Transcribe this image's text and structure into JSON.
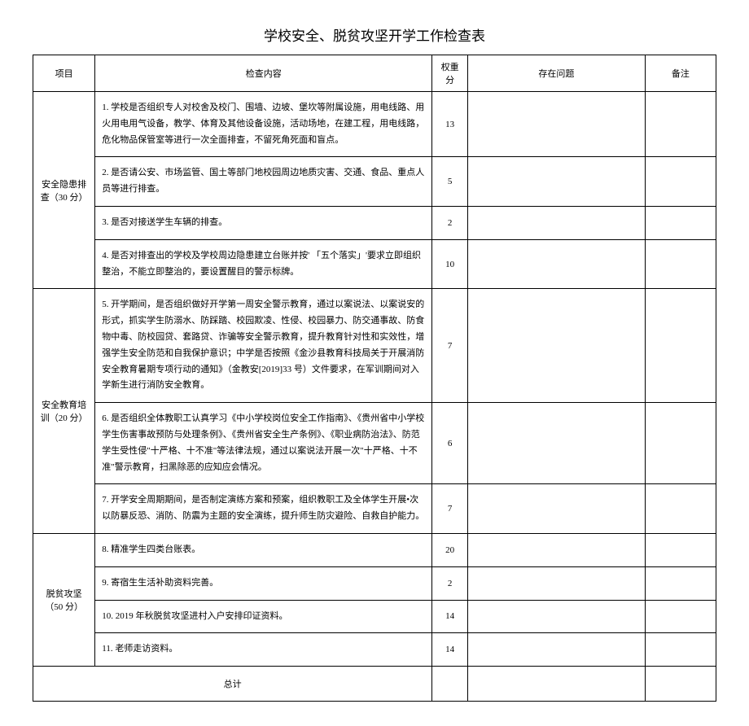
{
  "title": "学校安全、脱贫攻坚开学工作检查表",
  "headers": {
    "project": "项目",
    "content": "检查内容",
    "weight": "权重分",
    "issue": "存在问题",
    "remark": "备注"
  },
  "sections": [
    {
      "name": "安全隐患排查（30 分）",
      "rows": [
        {
          "content": "1. 学校是否组织专人对校舍及校门、围墙、边坡、堡坎等附属设施，用电线路、用火用电用气设备，教学、体育及其他设备设施，活动场地，在建工程，用电线路，危化物品保管室等进行一次全面排查，不留死角死面和盲点。",
          "weight": "13"
        },
        {
          "content": "2. 是否请公安、市场监管、国土等部门地校园周边地质灾害、交通、食品、重点人员等进行排查。",
          "weight": "5"
        },
        {
          "content": "3. 是否对接送学生车辆的排查。",
          "weight": "2"
        },
        {
          "content": "4. 是否对排查出的学校及学校周边隐患建立台账并按' 「五个落实」'要求立即组织整治，不能立即整治的，要设置醒目的警示标牌。",
          "weight": "10"
        }
      ]
    },
    {
      "name": "安全教育培训（20 分）",
      "rows": [
        {
          "content": "5. 开学期间，是否组织做好开学第一周安全警示教育，通过以案说法、以案说安的形式，抓实学生防溺水、防踩踏、校园欺凌、性侵、校园暴力、防交通事故、防食物中毒、防校园贷、套路贷、诈骗等安全警示教育，提升教育针对性和实效性，增强学生安全防范和自我保护意识；中学是否按照《金沙县教育科技局关于开展消防安全教育暑期专项行动的通知》（金教安[2019]33 号）文件要求，在军训期间对入学新生进行消防安全教育。",
          "weight": "7"
        },
        {
          "content": "6. 是否组织全体教职工认真学习《中小学校岗位安全工作指南》、《贵州省中小学校学生伤害事故预防与处理条例》、《贵州省安全生产条例》、《职业病防治法》、防范学生受性侵\"十严格、十不准\"等法律法规，通过以案说法开展一次\"十严格、十不准\"警示教育，扫黑除恶的应知应会情况。",
          "weight": "6"
        },
        {
          "content": "7. 开学安全周期期间，是否制定演练方案和预案，组织教职工及全体学生开展•次以防暴反恐、消防、防震为主题的安全演练，提升师生防灾避险、自救自护能力。",
          "weight": "7"
        }
      ]
    },
    {
      "name": "脱贫攻坚（50 分）",
      "rows": [
        {
          "content": "8. 精准学生四类台账表。",
          "weight": "20"
        },
        {
          "content": "9. 寄宿生生活补助资料完善。",
          "weight": "2"
        },
        {
          "content": "10. 2019 年秋脱贫攻坚进村入户安排印证资料。",
          "weight": "14"
        },
        {
          "content": "11. 老师走访资料。",
          "weight": "14"
        }
      ]
    }
  ],
  "total_label": "总计"
}
